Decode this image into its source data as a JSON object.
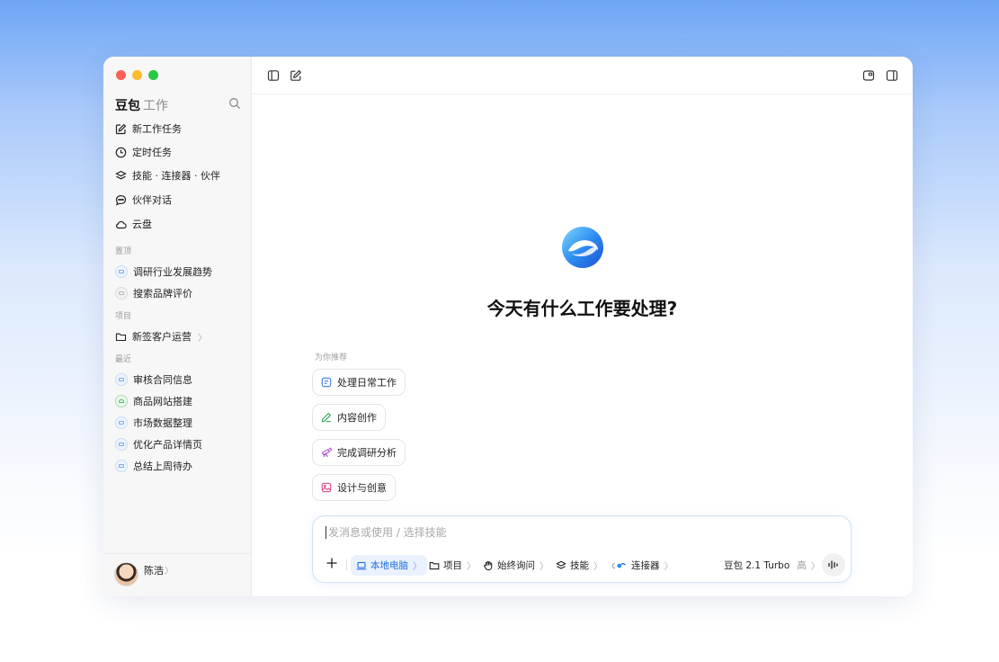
{
  "sidebar": {
    "brand_main": "豆包",
    "brand_sub": "工作",
    "nav": [
      {
        "label": "新工作任务",
        "icon": "edit-icon"
      },
      {
        "label": "定时任务",
        "icon": "clock-icon"
      },
      {
        "label": "技能 · 连接器 · 伙伴",
        "icon": "layers-icon"
      },
      {
        "label": "伙伴对话",
        "icon": "chat-bubble-icon"
      },
      {
        "label": "云盘",
        "icon": "cloud-icon"
      }
    ],
    "pinned_label": "置顶",
    "pinned": [
      "调研行业发展趋势",
      "搜索品牌评价"
    ],
    "projects_label": "项目",
    "projects": [
      {
        "label": "新签客户运营",
        "chevron": "〉"
      }
    ],
    "recent_label": "最近",
    "recent": [
      "审核合同信息",
      "商品网站搭建",
      "市场数据整理",
      "优化产品详情页",
      "总结上周待办"
    ],
    "user": {
      "name": "陈浩",
      "chevron": "〉"
    }
  },
  "main": {
    "headline": "今天有什么工作要处理?",
    "recommend_label": "为你推荐",
    "suggestions": [
      {
        "label": "处理日常工作",
        "icon": "document-icon",
        "color": "#3b7be6"
      },
      {
        "label": "内容创作",
        "icon": "pen-icon",
        "color": "#2aa45a"
      },
      {
        "label": "完成调研分析",
        "icon": "telescope-icon",
        "color": "#b04fd6"
      },
      {
        "label": "设计与创意",
        "icon": "image-icon",
        "color": "#e0488a"
      }
    ]
  },
  "composer": {
    "placeholder": "发消息或使用 / 选择技能",
    "local": "本地电脑",
    "project": "项目",
    "ask": "始终询问",
    "skills": "技能",
    "connectors": "连接器",
    "model": "豆包 2.1 Turbo",
    "model_level": "高",
    "chevron": "〉"
  },
  "colors": {
    "accent": "#1f6fe0",
    "window_bg": "#ffffff",
    "sidebar_bg": "#f7f7f8"
  }
}
